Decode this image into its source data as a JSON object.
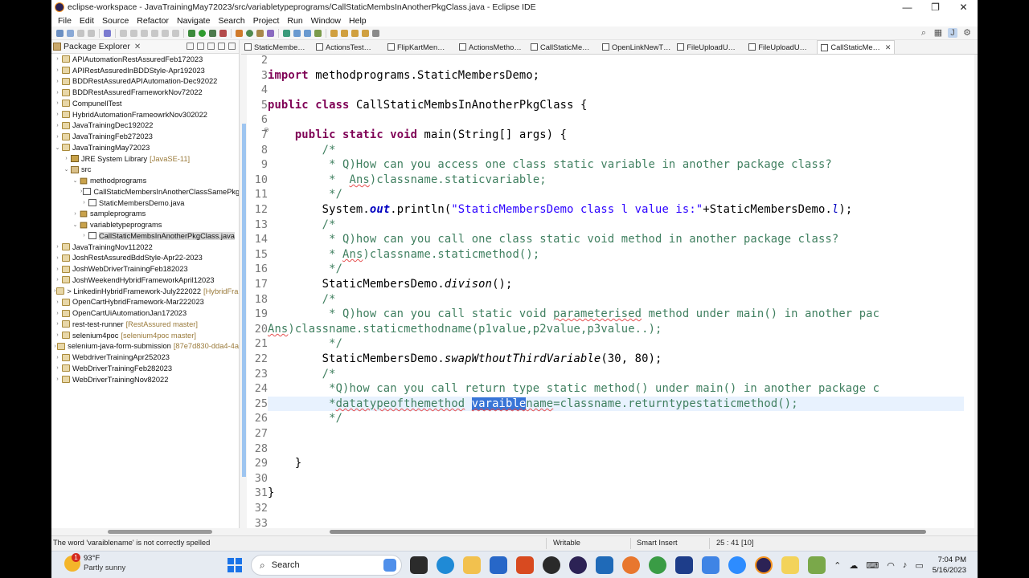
{
  "window": {
    "title": "eclipse-workspace - JavaTrainingMay72023/src/variabletypeprograms/CallStaticMembsInAnotherPkgClass.java - Eclipse IDE",
    "min": "—",
    "max": "❐",
    "close": "✕"
  },
  "menu": [
    "File",
    "Edit",
    "Source",
    "Refactor",
    "Navigate",
    "Search",
    "Project",
    "Run",
    "Window",
    "Help"
  ],
  "package_explorer": {
    "title": "Package Explorer",
    "close": "✕",
    "tree": [
      {
        "label": "APIAutomationRestAssuredFeb172023",
        "kind": "proj",
        "twisty": "›",
        "indent": 0
      },
      {
        "label": "APIRestAssuredInBDDStyle-Apr192023",
        "kind": "proj",
        "twisty": "›",
        "indent": 0
      },
      {
        "label": "BDDRestAssuredAPIAutomation-Dec92022",
        "kind": "proj",
        "twisty": "›",
        "indent": 0
      },
      {
        "label": "BDDRestAssuredFrameworkNov72022",
        "kind": "proj",
        "twisty": "›",
        "indent": 0
      },
      {
        "label": "CompunellTest",
        "kind": "proj",
        "twisty": "›",
        "indent": 0
      },
      {
        "label": "HybridAutomationFrameowrkNov302022",
        "kind": "proj",
        "twisty": "›",
        "indent": 0
      },
      {
        "label": "JavaTrainingDec192022",
        "kind": "proj",
        "twisty": "›",
        "indent": 0
      },
      {
        "label": "JavaTrainingFeb272023",
        "kind": "proj",
        "twisty": "›",
        "indent": 0
      },
      {
        "label": "JavaTrainingMay72023",
        "kind": "proj",
        "twisty": "⌄",
        "indent": 0
      },
      {
        "label": "JRE System Library",
        "deco": "[JavaSE-11]",
        "kind": "lib",
        "twisty": "›",
        "indent": 1
      },
      {
        "label": "src",
        "kind": "src",
        "twisty": "⌄",
        "indent": 1
      },
      {
        "label": "methodprograms",
        "kind": "pkgi",
        "twisty": "⌄",
        "indent": 2
      },
      {
        "label": "CallStaticMembersInAnotherClassSamePkg",
        "kind": "java",
        "twisty": "›",
        "indent": 3
      },
      {
        "label": "StaticMembersDemo.java",
        "kind": "java",
        "twisty": "›",
        "indent": 3
      },
      {
        "label": "sampleprograms",
        "kind": "pkgi",
        "twisty": "›",
        "indent": 2
      },
      {
        "label": "variabletypeprograms",
        "kind": "pkgi",
        "twisty": "⌄",
        "indent": 2
      },
      {
        "label": "CallStaticMembsInAnotherPkgClass.java",
        "kind": "java",
        "twisty": "›",
        "indent": 3,
        "selected": true
      },
      {
        "label": "JavaTrainingNov112022",
        "kind": "proj",
        "twisty": "›",
        "indent": 0
      },
      {
        "label": "JoshRestAssuredBddStyle-Apr22-2023",
        "kind": "proj",
        "twisty": "›",
        "indent": 0
      },
      {
        "label": "JoshWebDriverTrainingFeb182023",
        "kind": "proj",
        "twisty": "›",
        "indent": 0
      },
      {
        "label": "JoshWeekendHybridFrameworkApril12023",
        "kind": "proj",
        "twisty": "›",
        "indent": 0
      },
      {
        "label": "> LinkedinHybridFramework-July222022",
        "deco": "[HybridFran",
        "kind": "proj",
        "twisty": "›",
        "indent": 0
      },
      {
        "label": "OpenCartHybridFramework-Mar222023",
        "kind": "proj",
        "twisty": "›",
        "indent": 0
      },
      {
        "label": "OpenCartUiAutomationJan172023",
        "kind": "proj",
        "twisty": "›",
        "indent": 0
      },
      {
        "label": "rest-test-runner",
        "deco": "[RestAssured master]",
        "kind": "proj",
        "twisty": "›",
        "indent": 0
      },
      {
        "label": "selenium4poc",
        "deco": "[selenium4poc master]",
        "kind": "proj",
        "twisty": "›",
        "indent": 0
      },
      {
        "label": "selenium-java-form-submission",
        "deco": "[87e7d830-dda4-4a",
        "kind": "proj",
        "twisty": "›",
        "indent": 0
      },
      {
        "label": "WebdriverTrainingApr252023",
        "kind": "proj",
        "twisty": "›",
        "indent": 0
      },
      {
        "label": "WebDriverTrainingFeb282023",
        "kind": "proj",
        "twisty": "›",
        "indent": 0
      },
      {
        "label": "WebDriverTrainingNov82022",
        "kind": "proj",
        "twisty": "›",
        "indent": 0
      }
    ]
  },
  "editor_tabs": [
    {
      "label": "StaticMembe…",
      "active": false
    },
    {
      "label": "ActionsTest…",
      "active": false
    },
    {
      "label": "FlipKartMen…",
      "active": false
    },
    {
      "label": "ActionsMetho…",
      "active": false
    },
    {
      "label": "CallStaticMe…",
      "active": false
    },
    {
      "label": "OpenLinkNewT…",
      "active": false
    },
    {
      "label": "FileUploadU…",
      "active": false
    },
    {
      "label": "FileUploadU…",
      "active": false
    },
    {
      "label": "CallStaticMe…",
      "active": true,
      "close": "✕"
    }
  ],
  "editor": {
    "line_numbers": [
      "2",
      "3",
      "4",
      "5",
      "6",
      "7",
      "8",
      "9",
      "10",
      "11",
      "12",
      "13",
      "14",
      "15",
      "16",
      "17",
      "18",
      "19",
      "20",
      "21",
      "22",
      "23",
      "24",
      "25",
      "26",
      "27",
      "28",
      "29",
      "30",
      "31",
      "32",
      "33"
    ],
    "code_lines": [
      {
        "text": ""
      },
      {
        "text": "import methodprograms.StaticMembersDemo;"
      },
      {
        "text": ""
      },
      {
        "text": "public class CallStaticMembsInAnotherPkgClass {"
      },
      {
        "text": ""
      },
      {
        "text": "    public static void main(String[] args) {"
      },
      {
        "text": "        /*"
      },
      {
        "text": "         * Q)How can you access one class static variable in another package class?"
      },
      {
        "text": "         *  Ans)classname.staticvariable;"
      },
      {
        "text": "         */"
      },
      {
        "text": "        System.out.println(\"StaticMembersDemo class l value is:\"+StaticMembersDemo.l);"
      },
      {
        "text": "        /*"
      },
      {
        "text": "         * Q)how can you call one class static void method in another package class?"
      },
      {
        "text": "         * Ans)classname.staticmethod();"
      },
      {
        "text": "         */"
      },
      {
        "text": "        StaticMembersDemo.divison();"
      },
      {
        "text": "        /*"
      },
      {
        "text": "         * Q)how can you call static void parameterised method under main() in another pac"
      },
      {
        "text": "Ans)classname.staticmethodname(p1value,p2value,p3value..);"
      },
      {
        "text": "         */"
      },
      {
        "text": "        StaticMembersDemo.swapWthoutThirdVariable(30, 80);"
      },
      {
        "text": "        /*"
      },
      {
        "text": "         *Q)how can you call return type static method() under main() in another package c"
      },
      {
        "text": "         *datatypeofthemethod varaiblename=classname.returntypestaticmethod();"
      },
      {
        "text": "         */"
      },
      {
        "text": ""
      },
      {
        "text": ""
      },
      {
        "text": "    }"
      },
      {
        "text": ""
      },
      {
        "text": "}"
      },
      {
        "text": ""
      }
    ]
  },
  "status": {
    "message": "The word 'varaiblename' is not correctly spelled",
    "writable": "Writable",
    "insert_mode": "Smart Insert",
    "position": "25 : 41 [10]"
  },
  "taskbar": {
    "weather_temp": "93°F",
    "weather_desc": "Partly sunny",
    "weather_badge": "1",
    "search_placeholder": "Search",
    "time": "7:04 PM",
    "date": "5/16/2023"
  },
  "colors": {
    "keyword": "#7f0055",
    "comment": "#3f7f5f",
    "string": "#2a00ff",
    "field": "#0000c0",
    "selection": "#3875d7",
    "current_line": "#e8f2fe"
  }
}
